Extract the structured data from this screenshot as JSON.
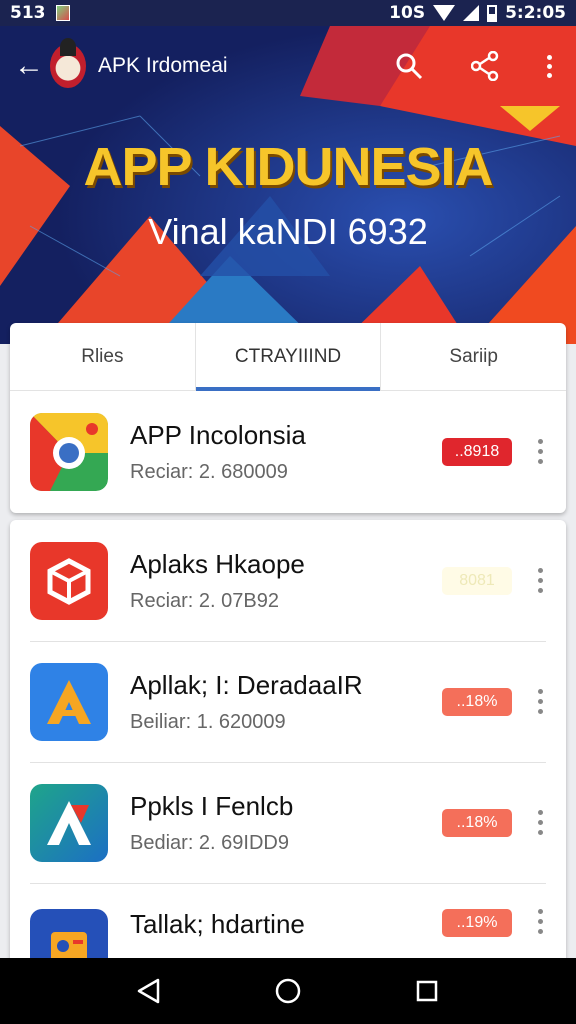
{
  "status_bar": {
    "time": "513",
    "right_text": "10S",
    "clock": "5:2:05",
    "icons": [
      "image-icon",
      "wifi-icon",
      "signal-icon",
      "battery-icon"
    ]
  },
  "app_bar": {
    "title": "APK Irdomeai",
    "icons": [
      "back-icon",
      "search-icon",
      "share-icon",
      "more-vert-icon"
    ]
  },
  "hero": {
    "title": "APP KIDUNESIA",
    "subtitle": "Vinal kaNDI 6932"
  },
  "tabs": [
    {
      "label": "Rlies",
      "active": false
    },
    {
      "label": "CTRAYIIIND",
      "active": true
    },
    {
      "label": "Sariip",
      "active": false
    }
  ],
  "apps_card1": [
    {
      "name": "APP Incolonsia",
      "sub": "Reciar: 2. 680009",
      "badge": "..8918",
      "badge_color": "#e0262d",
      "icon": "chrome-style-icon"
    }
  ],
  "apps_card2": [
    {
      "name": "Aplaks Hkaope",
      "sub": "Reciar: 2. 07B92",
      "badge": "8081",
      "badge_color": "#fffbe6",
      "icon": "cube-icon"
    },
    {
      "name": "Apllak; I: DeradaaIR",
      "sub": "Beiliar: 1. 620009",
      "badge": "..18%",
      "badge_color": "#f46f5a",
      "icon": "letter-a-icon"
    },
    {
      "name": "Ppkls I Fenlcb",
      "sub": "Bediar: 2. 69IDD9",
      "badge": "..18%",
      "badge_color": "#f46f5a",
      "icon": "letter-a-red-icon"
    },
    {
      "name": "Tallak; hdartine",
      "sub": "",
      "badge": "..19%",
      "badge_color": "#f46f5a",
      "icon": "tools-icon"
    }
  ],
  "colors": {
    "hero_bg": "#17276b",
    "accent_red": "#e0262d",
    "tab_indicator": "#3a6fc4",
    "title_gold": "#f6c52a"
  }
}
